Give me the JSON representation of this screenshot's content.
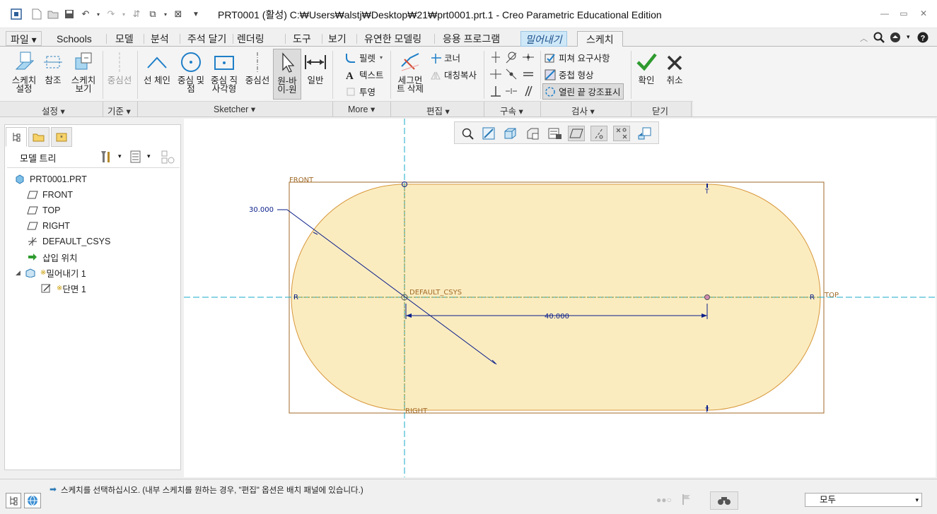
{
  "window": {
    "title": "PRT0001 (활성) C:₩Users₩alstj₩Desktop₩21₩prt0001.prt.1 - Creo Parametric Educational Edition"
  },
  "tabs": [
    {
      "label": "파일"
    },
    {
      "label": "Schools"
    },
    {
      "label": "모델"
    },
    {
      "label": "분석"
    },
    {
      "label": "주석 달기"
    },
    {
      "label": "렌더링"
    },
    {
      "label": "도구"
    },
    {
      "label": "보기"
    },
    {
      "label": "유연한 모델링"
    },
    {
      "label": "응용 프로그램"
    },
    {
      "label": "밀어내기"
    },
    {
      "label": "스케치"
    }
  ],
  "ribbon": {
    "setup": {
      "sketch_setup": "스케치\n설정",
      "references": "참조",
      "sketch_view": "스케치\n보기",
      "group": "설정"
    },
    "datum": {
      "centerline": "중심선",
      "group": "기준"
    },
    "sketcher": {
      "line_chain": "선 체인",
      "center_point_circle": "중심 및\n점",
      "center_rectangle": "중심 직\n사각형",
      "centerline": "중심선",
      "circle_hover": "원-바\n이-원",
      "normal": "일반",
      "group": "Sketcher"
    },
    "more": {
      "fillet": "필렛",
      "text": "텍스트",
      "project": "투영",
      "group": "More"
    },
    "edit": {
      "divide": "세그먼\n트 삭제",
      "corner": "코너",
      "mirror": "대칭복사",
      "group": "편집"
    },
    "constrain": {
      "group": "구속"
    },
    "inspect": {
      "feature_req": "피쳐 요구사항",
      "overlap": "중첩 형상",
      "highlight_open": "열린 끝 강조표시",
      "group": "검사"
    },
    "close": {
      "ok": "확인",
      "cancel": "취소",
      "group": "닫기"
    }
  },
  "model_tree": {
    "title": "모델 트리",
    "items": [
      {
        "label": "PRT0001.PRT",
        "icon": "part-icon"
      },
      {
        "label": "FRONT",
        "icon": "datum-plane-icon"
      },
      {
        "label": "TOP",
        "icon": "datum-plane-icon"
      },
      {
        "label": "RIGHT",
        "icon": "datum-plane-icon"
      },
      {
        "label": "DEFAULT_CSYS",
        "icon": "csys-icon"
      },
      {
        "label": "삽입 위치",
        "icon": "insert-arrow-icon"
      },
      {
        "label": "밀어내기 1",
        "icon": "extrude-icon"
      },
      {
        "label": "단면 1",
        "icon": "section-icon"
      }
    ]
  },
  "sketch": {
    "plane_front": "FRONT",
    "plane_top": "TOP",
    "plane_right": "RIGHT",
    "csys": "DEFAULT_CSYS",
    "radius_dim": "30.000",
    "length_dim": "40.000",
    "label_r1_left": "R",
    "label_r1_right": "R",
    "label_t_top": "T",
    "label_t_bottom": "T",
    "fill_color": "#fbecc0",
    "stroke_color": "#d7973a",
    "dim_color": "#0a1e8a",
    "center_color": "#19a9c9"
  },
  "status": {
    "message": "스케치를 선택하십시오. (내부 스케치를 원하는 경우, \"편집\" 옵션은 배치 패널에 있습니다.)",
    "filter": "모두"
  }
}
